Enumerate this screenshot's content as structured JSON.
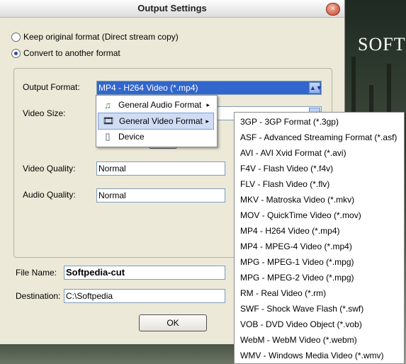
{
  "window": {
    "title": "Output Settings",
    "close_icon": "×"
  },
  "background": {
    "brand": "SOFT"
  },
  "mode": {
    "keep_original_label": "Keep original format (Direct stream copy)",
    "convert_label": "Convert to another format"
  },
  "fields": {
    "output_format_label": "Output Format:",
    "output_format_value": "MP4 - H264 Video (*.mp4)",
    "video_size_label": "Video Size:",
    "video_quality_label": "Video Quality:",
    "video_quality_value": "Normal",
    "audio_quality_label": "Audio Quality:",
    "audio_quality_value": "Normal",
    "file_name_label": "File Name:",
    "file_name_value": "Softpedia-cut",
    "destination_label": "Destination:",
    "destination_value": "C:\\Softpedia"
  },
  "buttons": {
    "ok": "OK",
    "dropdown_arrow": "▲▼",
    "submenu_arrow": "▸"
  },
  "category_menu": {
    "items": [
      {
        "label": "General Audio Format",
        "icon": "music-note-icon",
        "glyph": "♫"
      },
      {
        "label": "General Video Format",
        "icon": "film-reel-icon",
        "glyph": "🎞"
      },
      {
        "label": "Device",
        "icon": "device-icon",
        "glyph": "▯"
      }
    ]
  },
  "format_list": [
    "3GP - 3GP Format (*.3gp)",
    "ASF - Advanced Streaming Format (*.asf)",
    "AVI - AVI Xvid Format (*.avi)",
    "F4V - Flash Video (*.f4v)",
    "FLV - Flash Video (*.flv)",
    "MKV - Matroska Video (*.mkv)",
    "MOV - QuickTime Video (*.mov)",
    "MP4 - H264 Video (*.mp4)",
    "MP4 - MPEG-4 Video (*.mp4)",
    "MPG - MPEG-1 Video (*.mpg)",
    "MPG - MPEG-2 Video (*.mpg)",
    "RM - Real Video (*.rm)",
    "SWF - Shock Wave Flash (*.swf)",
    "VOB - DVD Video Object (*.vob)",
    "WebM - WebM Video (*.webm)",
    "WMV - Windows Media Video (*.wmv)"
  ]
}
